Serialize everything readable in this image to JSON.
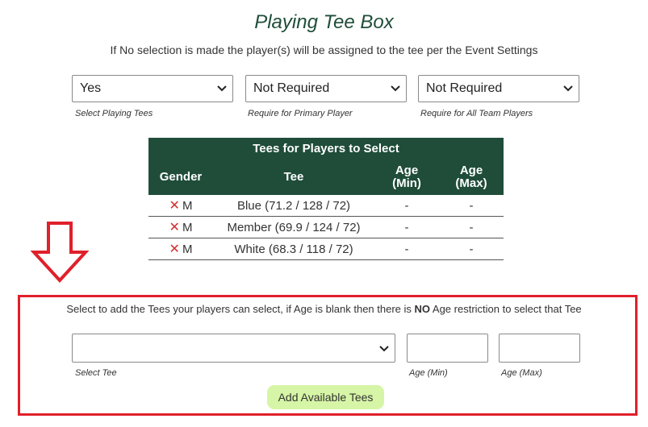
{
  "header": {
    "title": "Playing Tee Box",
    "subtitle": "If No selection is made the player(s) will be assigned to the tee per the Event Settings"
  },
  "settings": [
    {
      "value": "Yes",
      "helper": "Select Playing Tees"
    },
    {
      "value": "Not Required",
      "helper": "Require for Primary Player"
    },
    {
      "value": "Not Required",
      "helper": "Require for All Team Players"
    }
  ],
  "tees_table": {
    "caption": "Tees for Players to Select",
    "columns": {
      "gender": "Gender",
      "tee": "Tee",
      "age_min": [
        "Age",
        "(Min)"
      ],
      "age_max": [
        "Age",
        "(Max)"
      ]
    },
    "rows": [
      {
        "gender": "M",
        "tee": "Blue (71.2 / 128 / 72)",
        "age_min": "-",
        "age_max": "-"
      },
      {
        "gender": "M",
        "tee": "Member (69.9 / 124 / 72)",
        "age_min": "-",
        "age_max": "-"
      },
      {
        "gender": "M",
        "tee": "White (68.3 / 118 / 72)",
        "age_min": "-",
        "age_max": "-"
      }
    ],
    "remove_glyph": "✕"
  },
  "add_section": {
    "instruction_pre": "Select to add the Tees your players can select, if Age is blank then there is ",
    "instruction_bold": "NO",
    "instruction_post": " Age restriction to select that Tee",
    "tee_select_value": "",
    "tee_select_label": "Select Tee",
    "age_min_value": "",
    "age_min_label": "Age (Min)",
    "age_max_value": "",
    "age_max_label": "Age (Max)",
    "button_label": "Add Available Tees"
  },
  "colors": {
    "header_green": "#1f4d3a",
    "highlight_red": "#e0202b",
    "remove_red": "#d32f2f",
    "button_green": "#d6f5a6"
  },
  "icons": {
    "dropdown": "chevron-down-icon",
    "remove": "close-icon",
    "annotation": "arrow-down-icon"
  }
}
